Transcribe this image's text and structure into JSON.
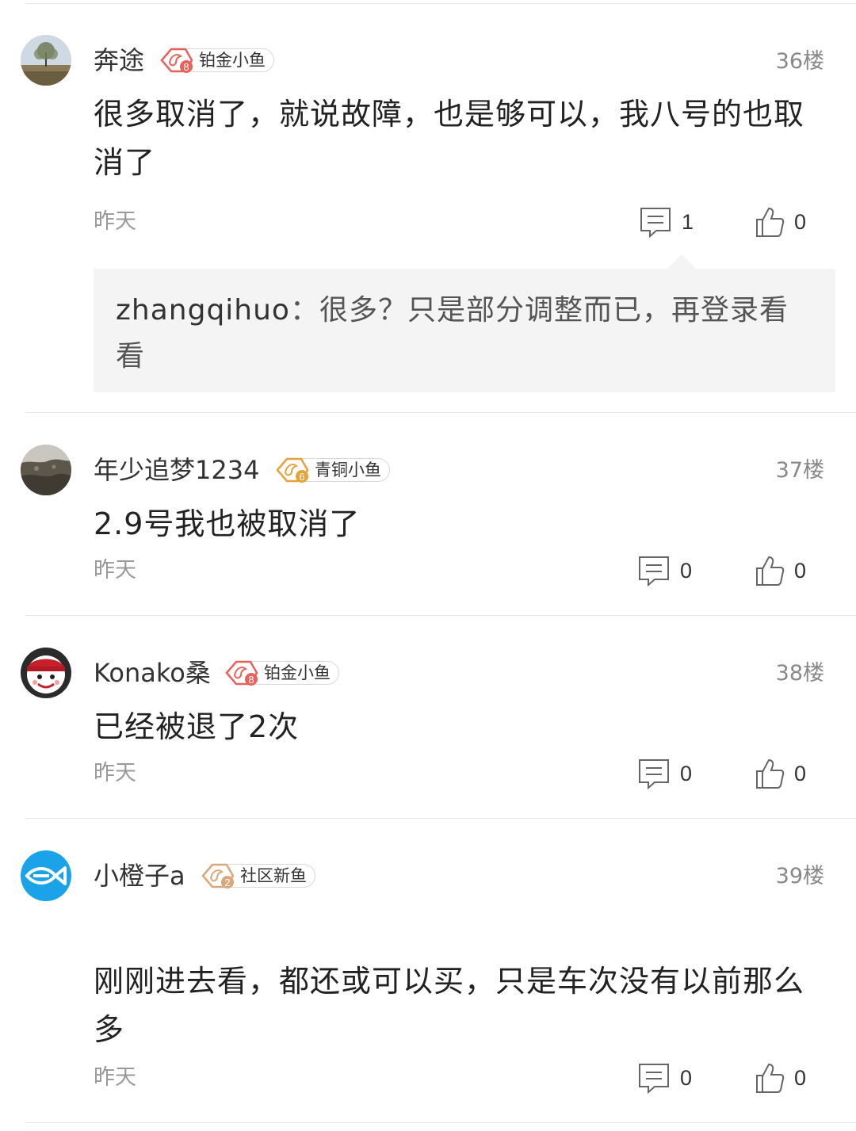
{
  "comments": [
    {
      "username": "奔途",
      "badge": {
        "level": "8",
        "label": "铂金小鱼",
        "color": "#e8625c"
      },
      "floor": "36楼",
      "content": "很多取消了，就说故障，也是够可以，我八号的也取消了",
      "time": "昨天",
      "reply_count": "1",
      "like_count": "0",
      "reply": {
        "user": "zhangqihuo",
        "separator": "：",
        "text": "很多？只是部分调整而已，再登录看看"
      }
    },
    {
      "username": "年少追梦1234",
      "badge": {
        "level": "6",
        "label": "青铜小鱼",
        "color": "#e8a23a"
      },
      "floor": "37楼",
      "content": "2.9号我也被取消了",
      "time": "昨天",
      "reply_count": "0",
      "like_count": "0"
    },
    {
      "username": "Konako桑",
      "badge": {
        "level": "8",
        "label": "铂金小鱼",
        "color": "#e8625c"
      },
      "floor": "38楼",
      "content": "已经被退了2次",
      "time": "昨天",
      "reply_count": "0",
      "like_count": "0"
    },
    {
      "username": "小橙子a",
      "badge": {
        "level": "2",
        "label": "社区新鱼",
        "color": "#d9a77a"
      },
      "floor": "39楼",
      "content": "刚刚进去看，都还或可以买，只是车次没有以前那么多",
      "time": "昨天",
      "reply_count": "0",
      "like_count": "0"
    }
  ],
  "icons": {
    "reply": "comment-bubble-icon",
    "like": "thumbs-up-icon",
    "badge": "fish-badge-icon"
  }
}
